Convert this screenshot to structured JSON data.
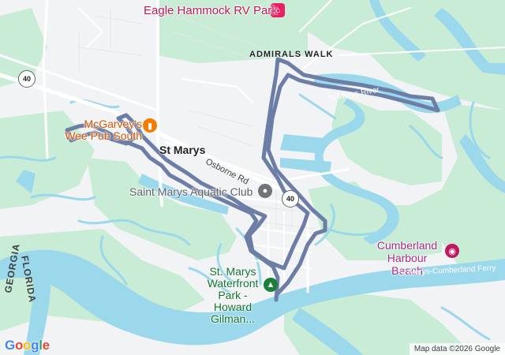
{
  "map": {
    "labels": {
      "eagle_hammock": "Eagle Hammock RV Park",
      "admirals_walk": "ADMIRALS WALK",
      "mcgarveys": "McGarvey's\nWee Pub South",
      "st_marys": "St Marys",
      "osborne_rd": "Osborne Rd",
      "aquatic_club": "Saint Marys Aquatic Club",
      "waterfront_park": "St. Marys\nWaterfront\nPark - Howard\nGilman...",
      "cumberland_beach": "Cumberland\nHarbour Beach",
      "st_marys_river": "St Marys River",
      "ferry": "St Marys-Cumberland Ferry",
      "georgia": "GEORGIA",
      "florida": "FLORIDA"
    },
    "route_shields": [
      "40",
      "40"
    ],
    "icons": {
      "lodging": "bed-icon",
      "bar": "beer-icon",
      "sports": "pool-icon",
      "park": "tree-icon",
      "camera": "camera-icon"
    },
    "colors": {
      "land": "#f1f3f4",
      "water": "#9bd8ec",
      "park": "#c8ecd5",
      "route": "#6d7ea6",
      "road": "#ffffff"
    }
  },
  "footer": {
    "logo": "Google",
    "attribution": "Map data ©2026 Google"
  }
}
